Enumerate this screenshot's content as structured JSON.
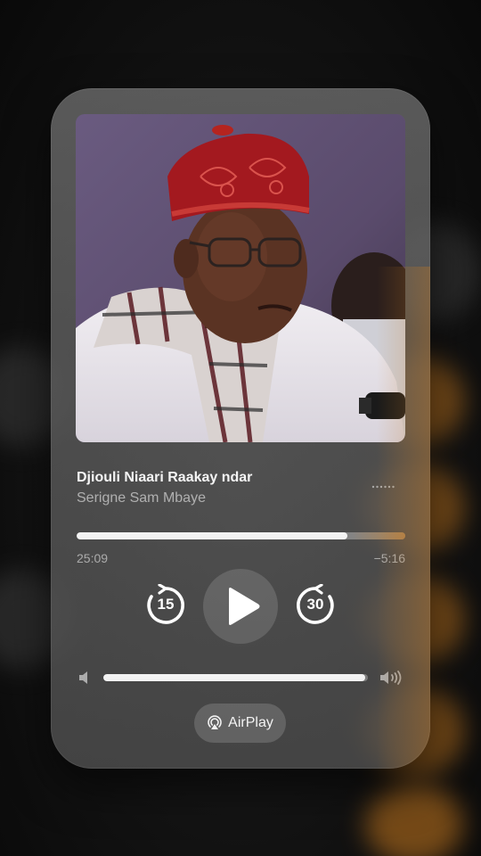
{
  "now_playing": {
    "title": "Djiouli Niaari Raakay ndar",
    "artist": "Serigne Sam Mbaye",
    "elapsed": "25:09",
    "remaining": "−5:16",
    "progress_fraction": 0.825,
    "artwork_icon": "album-artwork-portrait"
  },
  "controls": {
    "skip_back_label": "15",
    "skip_forward_label": "30",
    "skip_back_icon": "skip-back-icon",
    "play_icon": "play-icon",
    "skip_forward_icon": "skip-forward-icon",
    "more_icon": "more-dots-icon"
  },
  "volume": {
    "level_fraction": 0.99,
    "low_icon": "speaker-low-icon",
    "high_icon": "speaker-high-icon"
  },
  "airplay": {
    "label": "AirPlay",
    "icon": "airplay-icon"
  },
  "colors": {
    "accent_orange": "#c97a1f",
    "card_gray": "#5c5c5c",
    "text_primary": "#f4f4f4"
  }
}
